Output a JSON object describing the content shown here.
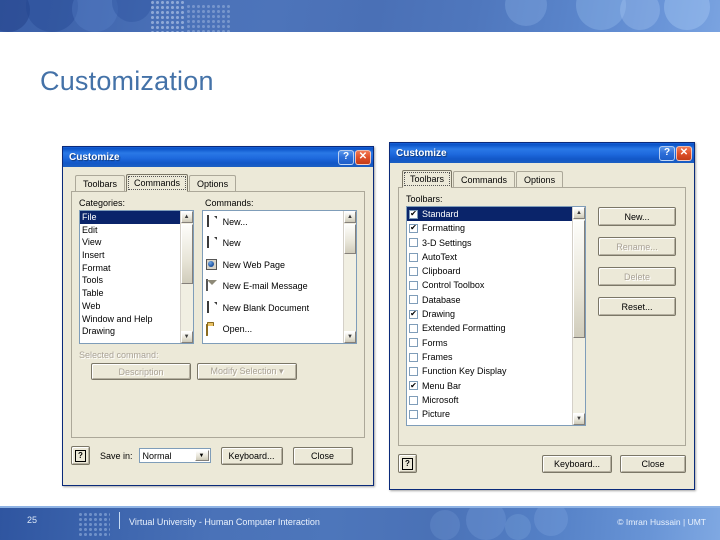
{
  "slide": {
    "title": "Customization",
    "accent_color": "#4472a8",
    "banner_color": "#4a71b8"
  },
  "footer": {
    "slide_number": "25",
    "center_text": "Virtual University - Human Computer Interaction",
    "copyright": "© Imran Hussain | UMT"
  },
  "left_dialog": {
    "title": "Customize",
    "help_button": "?",
    "close_button": "✕",
    "tabs": [
      {
        "label": "Toolbars",
        "active": false
      },
      {
        "label": "Commands",
        "active": true
      },
      {
        "label": "Options",
        "active": false
      }
    ],
    "categories_label": "Categories:",
    "categories": [
      {
        "label": "File",
        "selected": true
      },
      {
        "label": "Edit",
        "selected": false
      },
      {
        "label": "View",
        "selected": false
      },
      {
        "label": "Insert",
        "selected": false
      },
      {
        "label": "Format",
        "selected": false
      },
      {
        "label": "Tools",
        "selected": false
      },
      {
        "label": "Table",
        "selected": false
      },
      {
        "label": "Web",
        "selected": false
      },
      {
        "label": "Window and Help",
        "selected": false
      },
      {
        "label": "Drawing",
        "selected": false
      }
    ],
    "commands_label": "Commands:",
    "commands": [
      {
        "label": "New...",
        "icon": "document-icon"
      },
      {
        "label": "New",
        "icon": "document-icon"
      },
      {
        "label": "New Web Page",
        "icon": "web-page-icon"
      },
      {
        "label": "New E-mail Message",
        "icon": "email-icon"
      },
      {
        "label": "New Blank Document",
        "icon": "document-icon"
      },
      {
        "label": "Open...",
        "icon": "folder-open-icon"
      }
    ],
    "selected_command_label": "Selected command:",
    "description_button": "Description",
    "modify_selection_button": "Modify Selection ▾",
    "save_in_label": "Save in:",
    "save_in_value": "Normal",
    "keyboard_button": "Keyboard...",
    "close_label": "Close",
    "scroll_up": "▲",
    "scroll_down": "▼",
    "combo_arrow": "▼"
  },
  "right_dialog": {
    "title": "Customize",
    "help_button": "?",
    "close_button": "✕",
    "tabs": [
      {
        "label": "Toolbars",
        "active": true
      },
      {
        "label": "Commands",
        "active": false
      },
      {
        "label": "Options",
        "active": false
      }
    ],
    "toolbars_label": "Toolbars:",
    "toolbars": [
      {
        "label": "Standard",
        "checked": true,
        "selected": true
      },
      {
        "label": "Formatting",
        "checked": true,
        "selected": false
      },
      {
        "label": "3-D Settings",
        "checked": false,
        "selected": false
      },
      {
        "label": "AutoText",
        "checked": false,
        "selected": false
      },
      {
        "label": "Clipboard",
        "checked": false,
        "selected": false
      },
      {
        "label": "Control Toolbox",
        "checked": false,
        "selected": false
      },
      {
        "label": "Database",
        "checked": false,
        "selected": false
      },
      {
        "label": "Drawing",
        "checked": true,
        "selected": false
      },
      {
        "label": "Extended Formatting",
        "checked": false,
        "selected": false
      },
      {
        "label": "Forms",
        "checked": false,
        "selected": false
      },
      {
        "label": "Frames",
        "checked": false,
        "selected": false
      },
      {
        "label": "Function Key Display",
        "checked": false,
        "selected": false
      },
      {
        "label": "Menu Bar",
        "checked": true,
        "selected": false
      },
      {
        "label": "Microsoft",
        "checked": false,
        "selected": false
      },
      {
        "label": "Picture",
        "checked": false,
        "selected": false
      }
    ],
    "side_buttons": [
      {
        "label": "New...",
        "disabled": false
      },
      {
        "label": "Rename...",
        "disabled": true
      },
      {
        "label": "Delete",
        "disabled": true
      },
      {
        "label": "Reset...",
        "disabled": false
      }
    ],
    "keyboard_button": "Keyboard...",
    "close_label": "Close",
    "checkmark": "✔",
    "scroll_up": "▲",
    "scroll_down": "▼"
  }
}
